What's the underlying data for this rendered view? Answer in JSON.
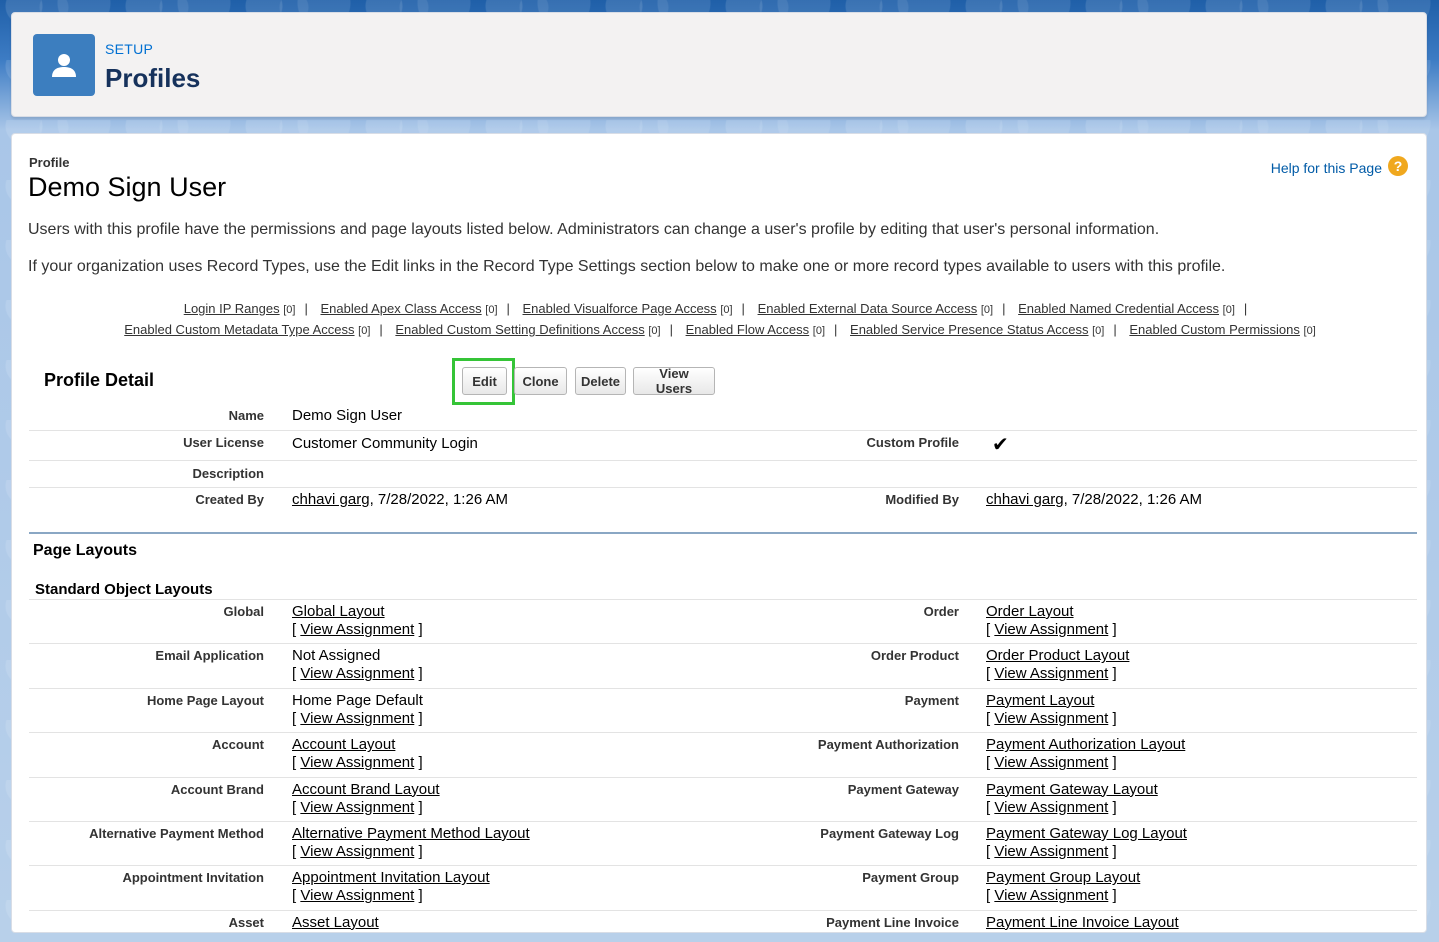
{
  "header": {
    "setup_label": "SETUP",
    "title": "Profiles",
    "icon": "user-icon"
  },
  "profile": {
    "label": "Profile",
    "name": "Demo Sign User",
    "help_link": "Help for this Page",
    "description_1": "Users with this profile have the permissions and page layouts listed below. Administrators can change a user's profile by editing that user's personal information.",
    "description_2": "If your organization uses Record Types, use the Edit links in the Record Type Settings section below to make one or more record types available to users with this profile."
  },
  "related_links": {
    "line1": [
      {
        "label": "Login IP Ranges",
        "count": "[0]"
      },
      {
        "label": "Enabled Apex Class Access",
        "count": "[0]"
      },
      {
        "label": "Enabled Visualforce Page Access",
        "count": "[0]"
      },
      {
        "label": "Enabled External Data Source Access",
        "count": "[0]"
      },
      {
        "label": "Enabled Named Credential Access",
        "count": "[0]"
      }
    ],
    "line2": [
      {
        "label": "Enabled Custom Metadata Type Access",
        "count": "[0]"
      },
      {
        "label": "Enabled Custom Setting Definitions Access",
        "count": "[0]"
      },
      {
        "label": "Enabled Flow Access",
        "count": "[0]"
      },
      {
        "label": "Enabled Service Presence Status Access",
        "count": "[0]"
      },
      {
        "label": "Enabled Custom Permissions",
        "count": "[0]"
      }
    ]
  },
  "profile_detail": {
    "title": "Profile Detail",
    "buttons": {
      "edit": "Edit",
      "clone": "Clone",
      "delete": "Delete",
      "view_users": "View Users"
    },
    "fields": {
      "name_label": "Name",
      "name_value": "Demo Sign User",
      "license_label": "User License",
      "license_value": "Customer Community Login",
      "custom_label": "Custom Profile",
      "custom_value": "✔",
      "description_label": "Description",
      "created_label": "Created By",
      "created_user": "chhavi garg",
      "created_date": ", 7/28/2022, 1:26 AM",
      "modified_label": "Modified By",
      "modified_user": "chhavi garg",
      "modified_date": ", 7/28/2022, 1:26 AM"
    }
  },
  "page_layouts": {
    "title": "Page Layouts",
    "subtitle": "Standard Object Layouts",
    "view_assignment": "View Assignment",
    "rows": [
      {
        "left_label": "Global",
        "left_value": "Global Layout",
        "left_linked": true,
        "right_label": "Order",
        "right_value": "Order Layout"
      },
      {
        "left_label": "Email Application",
        "left_value": "Not Assigned",
        "left_linked": false,
        "right_label": "Order Product",
        "right_value": "Order Product Layout"
      },
      {
        "left_label": "Home Page Layout",
        "left_value": "Home Page Default",
        "left_linked": false,
        "right_label": "Payment",
        "right_value": "Payment Layout"
      },
      {
        "left_label": "Account",
        "left_value": "Account Layout",
        "left_linked": true,
        "right_label": "Payment Authorization",
        "right_value": "Payment Authorization Layout"
      },
      {
        "left_label": "Account Brand",
        "left_value": "Account Brand Layout",
        "left_linked": true,
        "right_label": "Payment Gateway",
        "right_value": "Payment Gateway Layout"
      },
      {
        "left_label": "Alternative Payment Method",
        "left_value": "Alternative Payment Method Layout",
        "left_linked": true,
        "right_label": "Payment Gateway Log",
        "right_value": "Payment Gateway Log Layout"
      },
      {
        "left_label": "Appointment Invitation",
        "left_value": "Appointment Invitation Layout",
        "left_linked": true,
        "right_label": "Payment Group",
        "right_value": "Payment Group Layout"
      },
      {
        "left_label": "Asset",
        "left_value": "Asset Layout",
        "left_linked": true,
        "right_label": "Payment Line Invoice",
        "right_value": "Payment Line Invoice Layout"
      }
    ]
  },
  "colors": {
    "accent": "#35c437",
    "brand": "#3c7ebf",
    "link": "#015ba7"
  }
}
